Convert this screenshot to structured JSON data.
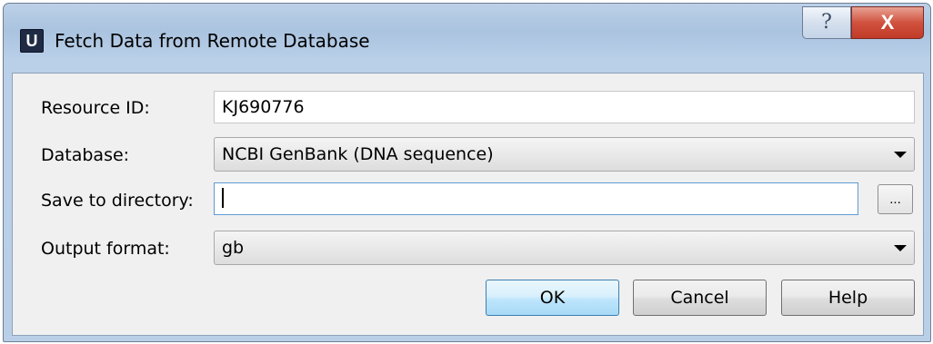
{
  "window": {
    "title": "Fetch Data from Remote Database",
    "app_icon_letter": "U",
    "help_glyph": "?",
    "close_glyph": "X"
  },
  "form": {
    "resource_id": {
      "label": "Resource ID:",
      "value": "KJ690776"
    },
    "database": {
      "label": "Database:",
      "selected": "NCBI GenBank (DNA sequence)"
    },
    "save_dir": {
      "label": "Save to directory:",
      "value": "",
      "browse_label": "..."
    },
    "output_format": {
      "label": "Output format:",
      "selected": "gb"
    }
  },
  "buttons": {
    "ok": "OK",
    "cancel": "Cancel",
    "help": "Help"
  }
}
